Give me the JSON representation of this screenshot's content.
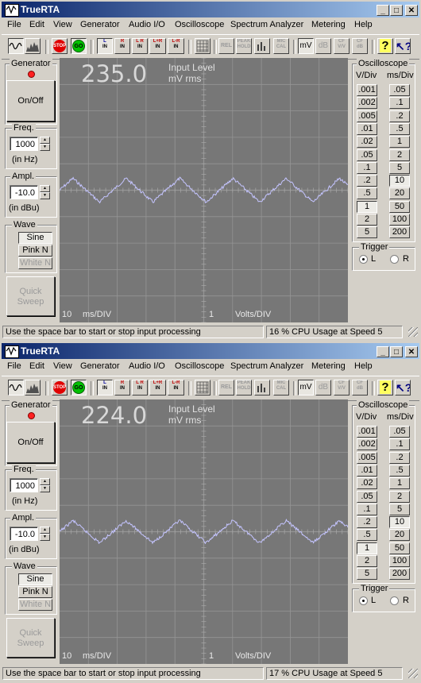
{
  "windows": [
    {
      "title": "TrueRTA",
      "menu": [
        "File",
        "Edit",
        "View",
        "Generator",
        "Audio I/O",
        "Oscilloscope",
        "Spectrum Analyzer",
        "Metering",
        "Help"
      ],
      "toolbar": {
        "stop_label": "STOP",
        "go_label": "GO",
        "l_in": [
          "L",
          "IN"
        ],
        "r_in": [
          "R",
          "IN"
        ],
        "lr_in": [
          "L R",
          "IN"
        ],
        "lplusr_in": [
          "L+R",
          "IN"
        ],
        "lminusr_in": [
          "L-R",
          "IN"
        ],
        "rel_label": "REL",
        "peak_hold": [
          "PEAK",
          "HOLD"
        ],
        "mic_cal": [
          "MIC",
          "CAL"
        ],
        "mv_label": "mV",
        "db_label": "dB",
        "cf_vv": [
          "CF",
          "V/V"
        ],
        "cf_db": [
          "CF",
          "dB"
        ]
      },
      "generator": {
        "title": "Generator",
        "onoff_label": "On/Off",
        "freq_title": "Freq.",
        "freq_value": "1000",
        "freq_unit": "(in Hz)",
        "ampl_title": "Ampl.",
        "ampl_value": "-10.0",
        "ampl_unit": "(in dBu)",
        "wave_title": "Wave",
        "wave_buttons": [
          "Sine",
          "Pink N",
          "White N"
        ],
        "wave_selected": "Sine",
        "quick_sweep": [
          "Quick",
          "Sweep"
        ]
      },
      "scope": {
        "readout": "235.0",
        "input_level": "Input Level",
        "unit": "mV rms",
        "ms_div_value": "10",
        "ms_div_label": "ms/DIV",
        "volts_div_value": "1",
        "volts_div_label": "Volts/DIV"
      },
      "oscilloscope": {
        "title": "Oscilloscope",
        "vdiv_header": "V/Div",
        "msdiv_header": "ms/Div",
        "vdiv": [
          ".001",
          ".002",
          ".005",
          ".01",
          ".02",
          ".05",
          ".1",
          ".2",
          ".5",
          "1",
          "2",
          "5"
        ],
        "msdiv": [
          ".05",
          ".1",
          ".2",
          ".5",
          "1",
          "2",
          "5",
          "10",
          "20",
          "50",
          "100",
          "200"
        ],
        "vdiv_selected": "1",
        "msdiv_selected": "10",
        "trigger_title": "Trigger",
        "trigger_l": "L",
        "trigger_r": "R",
        "trigger_selected": "L"
      },
      "status": {
        "hint": "Use the space bar to start or stop input processing",
        "cpu": "16 % CPU Usage at Speed 5"
      },
      "waveform": {
        "amplitude_divisions": 0.45,
        "period_ms": 18.5,
        "noise": 0.07
      }
    },
    {
      "title": "TrueRTA",
      "menu": [
        "File",
        "Edit",
        "View",
        "Generator",
        "Audio I/O",
        "Oscilloscope",
        "Spectrum Analyzer",
        "Metering",
        "Help"
      ],
      "toolbar": {
        "stop_label": "STOP",
        "go_label": "GO",
        "l_in": [
          "L",
          "IN"
        ],
        "r_in": [
          "R",
          "IN"
        ],
        "lr_in": [
          "L R",
          "IN"
        ],
        "lplusr_in": [
          "L+R",
          "IN"
        ],
        "lminusr_in": [
          "L-R",
          "IN"
        ],
        "rel_label": "REL",
        "peak_hold": [
          "PEAK",
          "HOLD"
        ],
        "mic_cal": [
          "MIC",
          "CAL"
        ],
        "mv_label": "mV",
        "db_label": "dB",
        "cf_vv": [
          "CF",
          "V/V"
        ],
        "cf_db": [
          "CF",
          "dB"
        ]
      },
      "generator": {
        "title": "Generator",
        "onoff_label": "On/Off",
        "freq_title": "Freq.",
        "freq_value": "1000",
        "freq_unit": "(in Hz)",
        "ampl_title": "Ampl.",
        "ampl_value": "-10.0",
        "ampl_unit": "(in dBu)",
        "wave_title": "Wave",
        "wave_buttons": [
          "Sine",
          "Pink N",
          "White N"
        ],
        "wave_selected": "Sine",
        "quick_sweep": [
          "Quick",
          "Sweep"
        ]
      },
      "scope": {
        "readout": "224.0",
        "input_level": "Input Level",
        "unit": "mV rms",
        "ms_div_value": "10",
        "ms_div_label": "ms/DIV",
        "volts_div_value": "1",
        "volts_div_label": "Volts/DIV"
      },
      "oscilloscope": {
        "title": "Oscilloscope",
        "vdiv_header": "V/Div",
        "msdiv_header": "ms/Div",
        "vdiv": [
          ".001",
          ".002",
          ".005",
          ".01",
          ".02",
          ".05",
          ".1",
          ".2",
          ".5",
          "1",
          "2",
          "5"
        ],
        "msdiv": [
          ".05",
          ".1",
          ".2",
          ".5",
          "1",
          "2",
          "5",
          "10",
          "20",
          "50",
          "100",
          "200"
        ],
        "vdiv_selected": "1",
        "msdiv_selected": "10",
        "trigger_title": "Trigger",
        "trigger_l": "L",
        "trigger_r": "R",
        "trigger_selected": "L"
      },
      "status": {
        "hint": "Use the space bar to start or stop input processing",
        "cpu": "17 % CPU Usage at Speed 5"
      },
      "waveform": {
        "amplitude_divisions": 0.42,
        "period_ms": 18.5,
        "noise": 0.07
      }
    }
  ],
  "colors": {
    "scope_bg": "#777777",
    "grid": "#959595",
    "trace": "#c4c4ff",
    "title_start": "#0a246a",
    "title_end": "#a6caf0"
  },
  "icons": [
    "scope-icon",
    "spectrum-icon",
    "grid-icon",
    "help-icon",
    "context-help-icon",
    "minimize-icon",
    "maximize-icon",
    "close-icon"
  ]
}
